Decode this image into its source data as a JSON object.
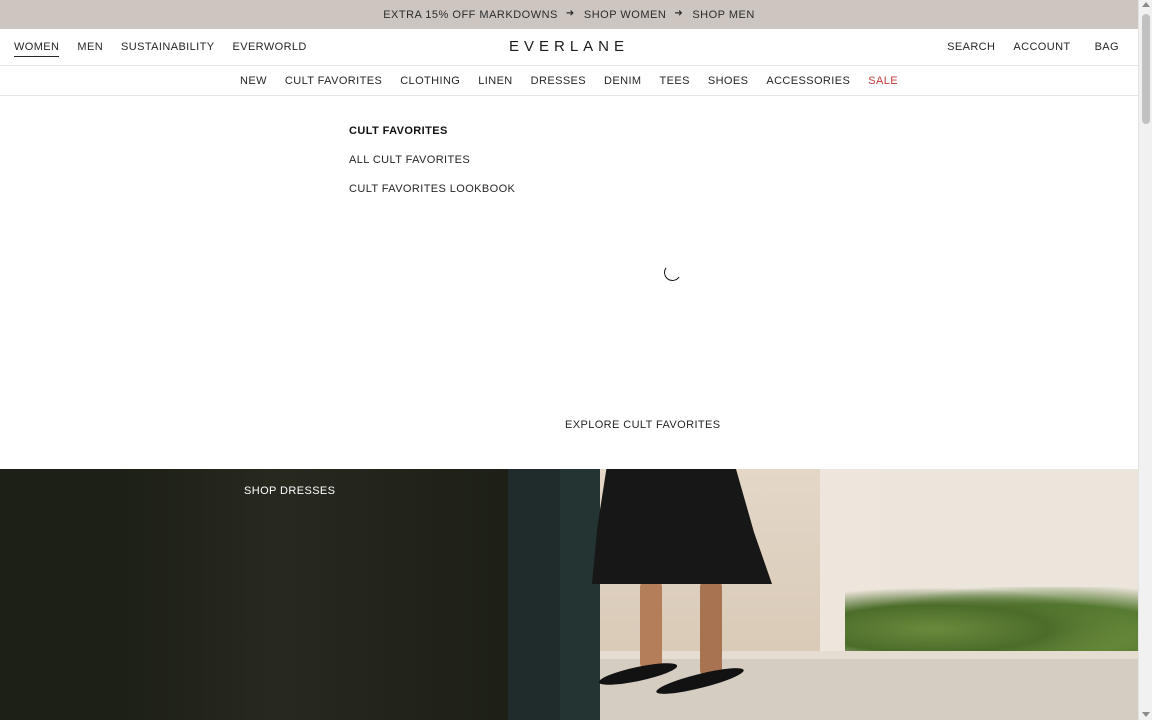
{
  "promo": {
    "offer": "EXTRA 15% OFF MARKDOWNS",
    "shop_women": "SHOP WOMEN",
    "shop_men": "SHOP MEN"
  },
  "header": {
    "logo": "EVERLANE",
    "left_nav": [
      "WOMEN",
      "MEN",
      "SUSTAINABILITY",
      "EVERWORLD"
    ],
    "active": "WOMEN",
    "right_nav": {
      "search": "SEARCH",
      "account": "ACCOUNT",
      "bag": "BAG"
    }
  },
  "categories": [
    "NEW",
    "CULT FAVORITES",
    "CLOTHING",
    "LINEN",
    "DRESSES",
    "DENIM",
    "TEES",
    "SHOES",
    "ACCESSORIES",
    "SALE"
  ],
  "mega_menu": {
    "heading": "CULT FAVORITES",
    "items": [
      "ALL CULT FAVORITES",
      "CULT FAVORITES LOOKBOOK"
    ],
    "explore": "EXPLORE CULT FAVORITES"
  },
  "hero": {
    "label": "SHOP DRESSES"
  },
  "colors": {
    "promo_bg": "#cdc6c0",
    "sale": "#c53a3a",
    "text": "#262626"
  }
}
